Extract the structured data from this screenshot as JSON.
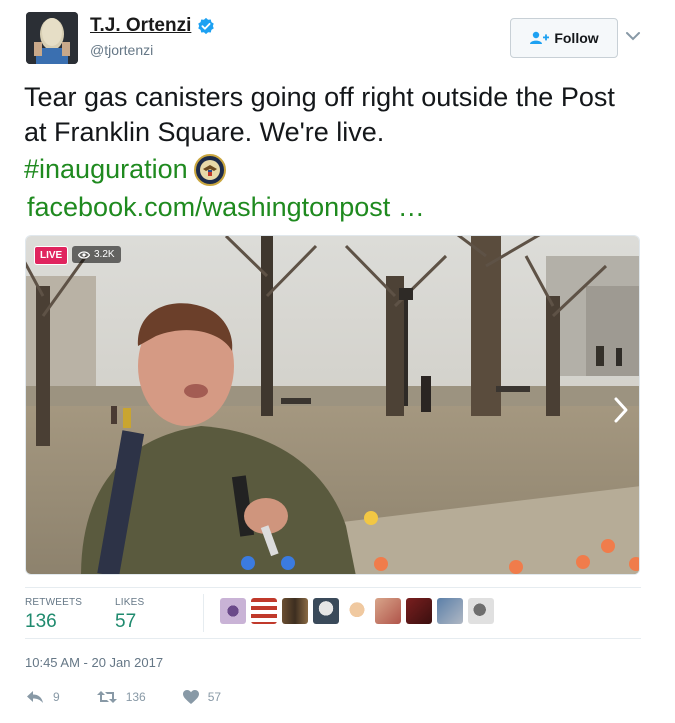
{
  "author": {
    "display_name": "T.J. Ortenzi",
    "handle": "@tjortenzi",
    "verified": true
  },
  "header": {
    "follow_label": "Follow"
  },
  "tweet": {
    "text": "Tear gas canisters going off right outside the Post at Franklin Square. We're live.",
    "hashtag": "#inauguration",
    "link": "facebook.com/washingtonpost …"
  },
  "media": {
    "live_label": "LIVE",
    "viewer_count": "3.2K"
  },
  "stats": {
    "retweets_label": "RETWEETS",
    "retweets_value": "136",
    "likes_label": "LIKES",
    "likes_value": "57",
    "liker_avatar_count": 9
  },
  "timestamp": "10:45 AM - 20 Jan 2017",
  "actions": {
    "reply_count": "9",
    "retweet_count": "136",
    "like_count": "57"
  },
  "colors": {
    "link_green": "#1f8a1f",
    "stat_green": "#1f8a6e",
    "live_red": "#e0245e",
    "verified_blue": "#1da1f2"
  }
}
